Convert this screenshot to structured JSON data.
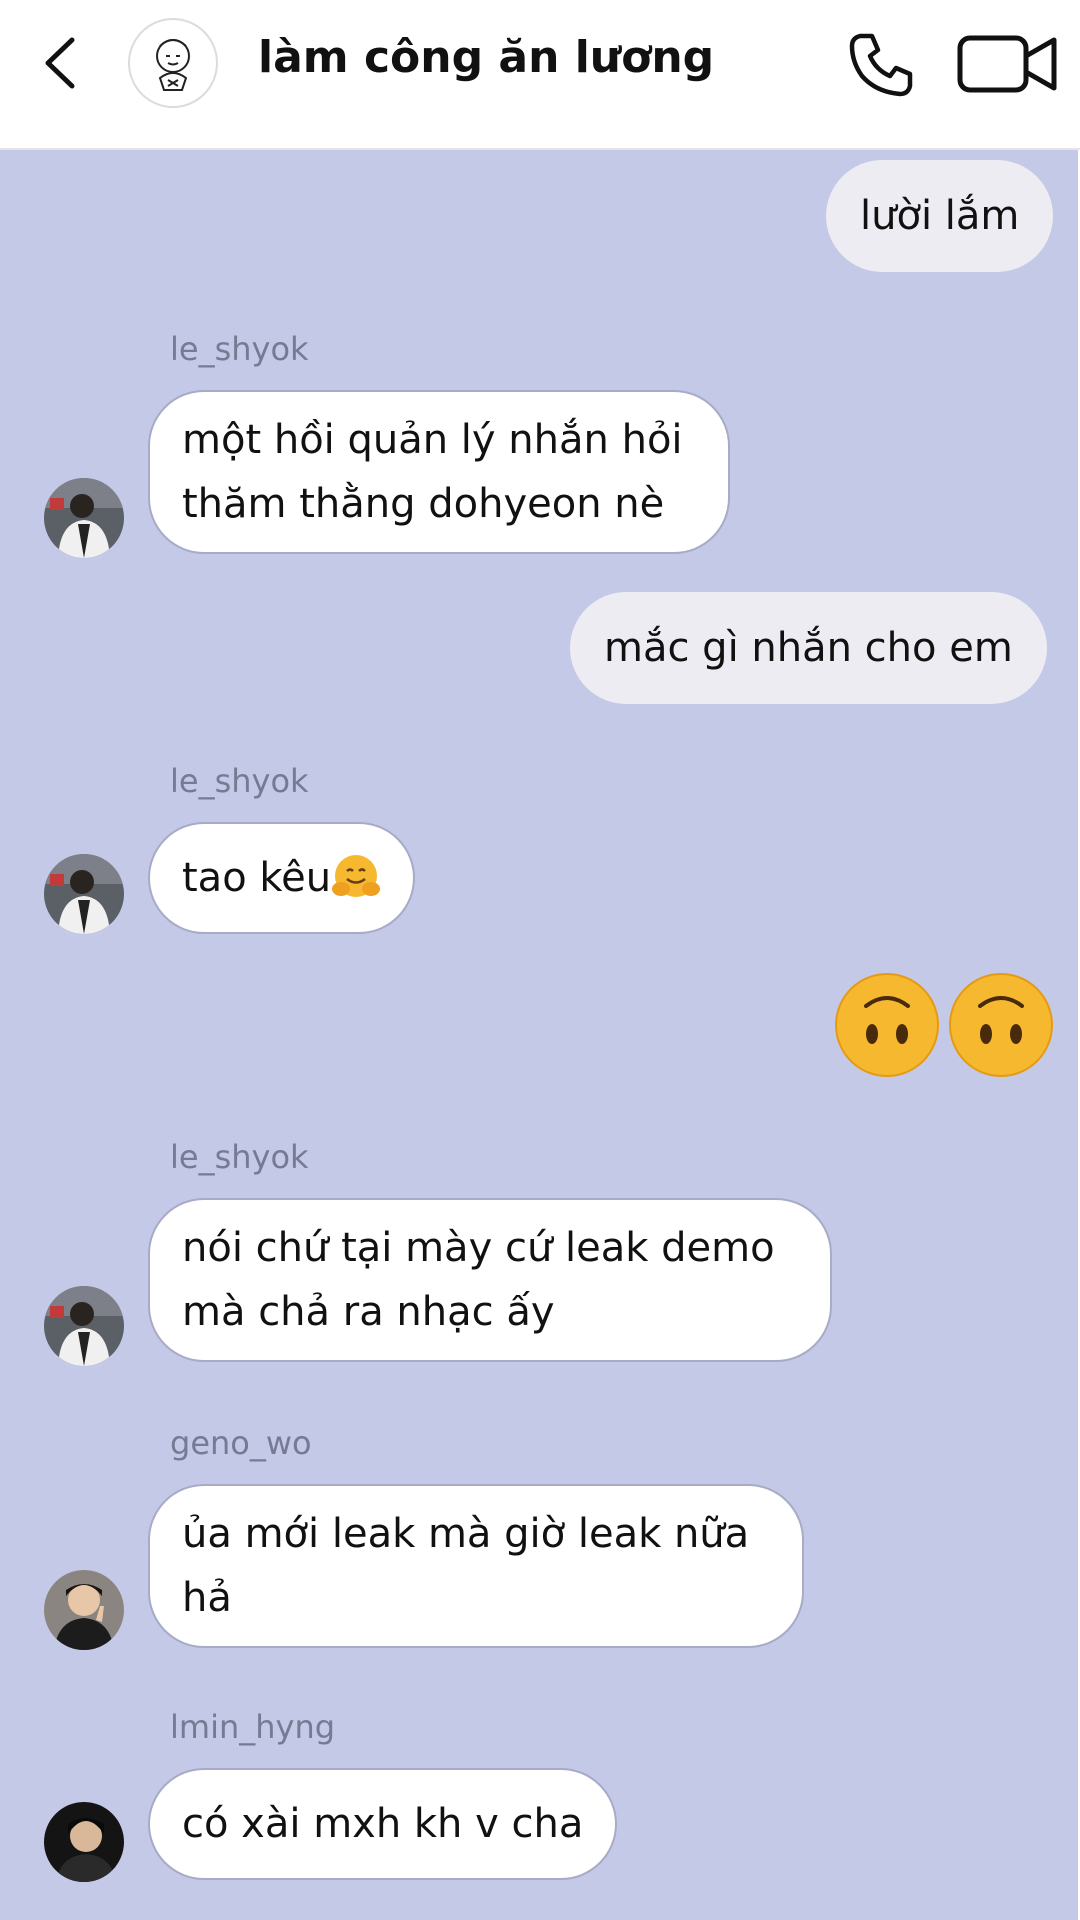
{
  "header": {
    "title": "làm công ăn lương",
    "back_icon": "chevron-left-icon",
    "call_icon": "phone-icon",
    "video_icon": "video-camera-icon"
  },
  "colors": {
    "chat_background": "#c5c9e8",
    "outgoing_bubble": "#ececf2",
    "incoming_bubble": "#ffffff",
    "sender_name": "#777a93"
  },
  "messages": [
    {
      "direction": "outgoing",
      "text": "lười lắm"
    },
    {
      "direction": "incoming",
      "sender": "le_shyok",
      "text": "một hồi quản lý nhắn hỏi thăm thằng dohyeon nè"
    },
    {
      "direction": "outgoing",
      "text": "mắc gì nhắn cho em"
    },
    {
      "direction": "incoming",
      "sender": "le_shyok",
      "text": "tao kêu",
      "emoji": "hugging-face-emoji"
    },
    {
      "direction": "outgoing",
      "emoji": [
        "upside-down-face-emoji",
        "upside-down-face-emoji"
      ]
    },
    {
      "direction": "incoming",
      "sender": "le_shyok",
      "text": "nói chứ tại mày cứ leak demo mà chả ra nhạc ấy"
    },
    {
      "direction": "incoming",
      "sender": "geno_wo",
      "text": "ủa mới leak mà giờ leak nữa hả"
    },
    {
      "direction": "incoming",
      "sender": "lmin_hyng",
      "text": "có xài mxh kh v cha"
    }
  ]
}
